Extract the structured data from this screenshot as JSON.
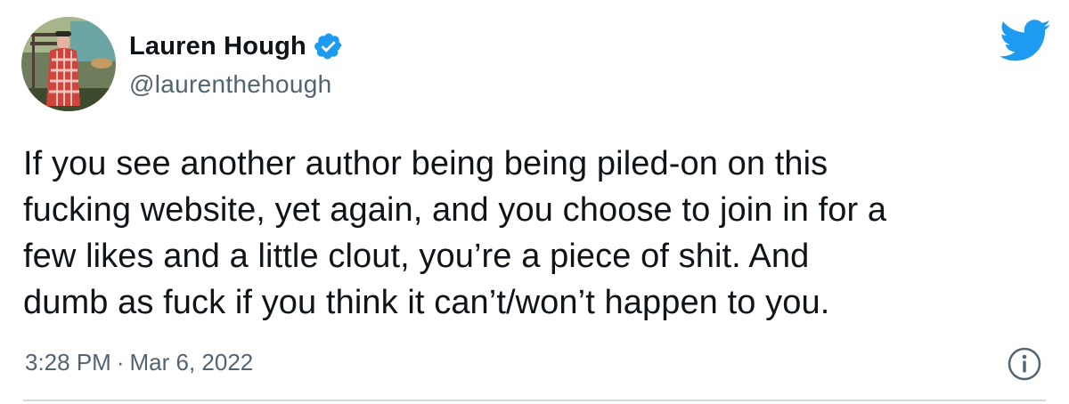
{
  "author": {
    "display_name": "Lauren Hough",
    "handle": "@laurenthehough",
    "verified": true
  },
  "tweet": {
    "text": "If you see another author being being piled-on on this\nfucking website, yet again, and you choose to join in for a\nfew likes and a little clout, you’re a piece of shit. And\ndumb as fuck if you think it can’t/won’t happen to you.",
    "time": "3:28 PM",
    "separator": "·",
    "date": "Mar 6, 2022"
  },
  "icons": {
    "brand": "twitter-bird-icon",
    "verified": "verified-badge-icon",
    "info": "info-icon"
  },
  "colors": {
    "twitter_blue": "#1d9bf0",
    "text": "#0f1419",
    "secondary_text": "#536471",
    "divider": "#cfd9de"
  }
}
